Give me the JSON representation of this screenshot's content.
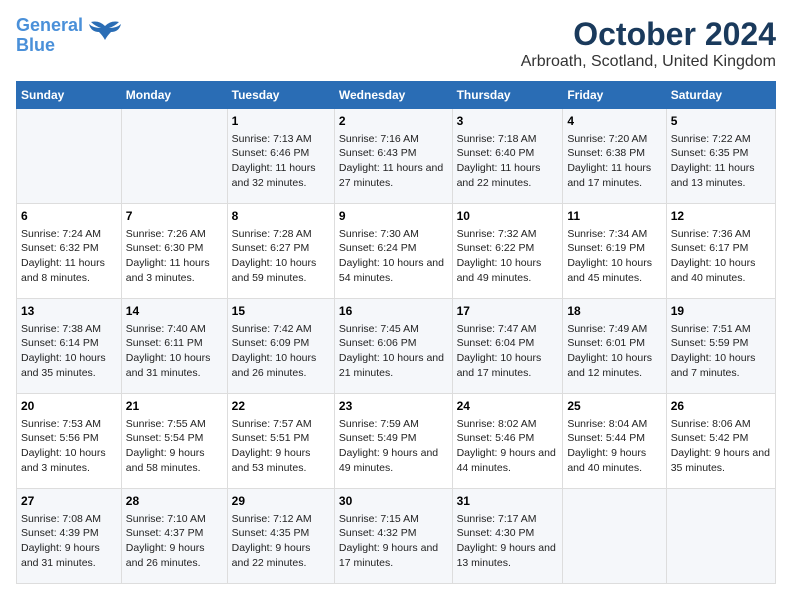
{
  "logo": {
    "line1": "General",
    "line2": "Blue"
  },
  "title": "October 2024",
  "subtitle": "Arbroath, Scotland, United Kingdom",
  "headers": [
    "Sunday",
    "Monday",
    "Tuesday",
    "Wednesday",
    "Thursday",
    "Friday",
    "Saturday"
  ],
  "weeks": [
    [
      {
        "day": "",
        "text": ""
      },
      {
        "day": "",
        "text": ""
      },
      {
        "day": "1",
        "text": "Sunrise: 7:13 AM\nSunset: 6:46 PM\nDaylight: 11 hours and 32 minutes."
      },
      {
        "day": "2",
        "text": "Sunrise: 7:16 AM\nSunset: 6:43 PM\nDaylight: 11 hours and 27 minutes."
      },
      {
        "day": "3",
        "text": "Sunrise: 7:18 AM\nSunset: 6:40 PM\nDaylight: 11 hours and 22 minutes."
      },
      {
        "day": "4",
        "text": "Sunrise: 7:20 AM\nSunset: 6:38 PM\nDaylight: 11 hours and 17 minutes."
      },
      {
        "day": "5",
        "text": "Sunrise: 7:22 AM\nSunset: 6:35 PM\nDaylight: 11 hours and 13 minutes."
      }
    ],
    [
      {
        "day": "6",
        "text": "Sunrise: 7:24 AM\nSunset: 6:32 PM\nDaylight: 11 hours and 8 minutes."
      },
      {
        "day": "7",
        "text": "Sunrise: 7:26 AM\nSunset: 6:30 PM\nDaylight: 11 hours and 3 minutes."
      },
      {
        "day": "8",
        "text": "Sunrise: 7:28 AM\nSunset: 6:27 PM\nDaylight: 10 hours and 59 minutes."
      },
      {
        "day": "9",
        "text": "Sunrise: 7:30 AM\nSunset: 6:24 PM\nDaylight: 10 hours and 54 minutes."
      },
      {
        "day": "10",
        "text": "Sunrise: 7:32 AM\nSunset: 6:22 PM\nDaylight: 10 hours and 49 minutes."
      },
      {
        "day": "11",
        "text": "Sunrise: 7:34 AM\nSunset: 6:19 PM\nDaylight: 10 hours and 45 minutes."
      },
      {
        "day": "12",
        "text": "Sunrise: 7:36 AM\nSunset: 6:17 PM\nDaylight: 10 hours and 40 minutes."
      }
    ],
    [
      {
        "day": "13",
        "text": "Sunrise: 7:38 AM\nSunset: 6:14 PM\nDaylight: 10 hours and 35 minutes."
      },
      {
        "day": "14",
        "text": "Sunrise: 7:40 AM\nSunset: 6:11 PM\nDaylight: 10 hours and 31 minutes."
      },
      {
        "day": "15",
        "text": "Sunrise: 7:42 AM\nSunset: 6:09 PM\nDaylight: 10 hours and 26 minutes."
      },
      {
        "day": "16",
        "text": "Sunrise: 7:45 AM\nSunset: 6:06 PM\nDaylight: 10 hours and 21 minutes."
      },
      {
        "day": "17",
        "text": "Sunrise: 7:47 AM\nSunset: 6:04 PM\nDaylight: 10 hours and 17 minutes."
      },
      {
        "day": "18",
        "text": "Sunrise: 7:49 AM\nSunset: 6:01 PM\nDaylight: 10 hours and 12 minutes."
      },
      {
        "day": "19",
        "text": "Sunrise: 7:51 AM\nSunset: 5:59 PM\nDaylight: 10 hours and 7 minutes."
      }
    ],
    [
      {
        "day": "20",
        "text": "Sunrise: 7:53 AM\nSunset: 5:56 PM\nDaylight: 10 hours and 3 minutes."
      },
      {
        "day": "21",
        "text": "Sunrise: 7:55 AM\nSunset: 5:54 PM\nDaylight: 9 hours and 58 minutes."
      },
      {
        "day": "22",
        "text": "Sunrise: 7:57 AM\nSunset: 5:51 PM\nDaylight: 9 hours and 53 minutes."
      },
      {
        "day": "23",
        "text": "Sunrise: 7:59 AM\nSunset: 5:49 PM\nDaylight: 9 hours and 49 minutes."
      },
      {
        "day": "24",
        "text": "Sunrise: 8:02 AM\nSunset: 5:46 PM\nDaylight: 9 hours and 44 minutes."
      },
      {
        "day": "25",
        "text": "Sunrise: 8:04 AM\nSunset: 5:44 PM\nDaylight: 9 hours and 40 minutes."
      },
      {
        "day": "26",
        "text": "Sunrise: 8:06 AM\nSunset: 5:42 PM\nDaylight: 9 hours and 35 minutes."
      }
    ],
    [
      {
        "day": "27",
        "text": "Sunrise: 7:08 AM\nSunset: 4:39 PM\nDaylight: 9 hours and 31 minutes."
      },
      {
        "day": "28",
        "text": "Sunrise: 7:10 AM\nSunset: 4:37 PM\nDaylight: 9 hours and 26 minutes."
      },
      {
        "day": "29",
        "text": "Sunrise: 7:12 AM\nSunset: 4:35 PM\nDaylight: 9 hours and 22 minutes."
      },
      {
        "day": "30",
        "text": "Sunrise: 7:15 AM\nSunset: 4:32 PM\nDaylight: 9 hours and 17 minutes."
      },
      {
        "day": "31",
        "text": "Sunrise: 7:17 AM\nSunset: 4:30 PM\nDaylight: 9 hours and 13 minutes."
      },
      {
        "day": "",
        "text": ""
      },
      {
        "day": "",
        "text": ""
      }
    ]
  ]
}
